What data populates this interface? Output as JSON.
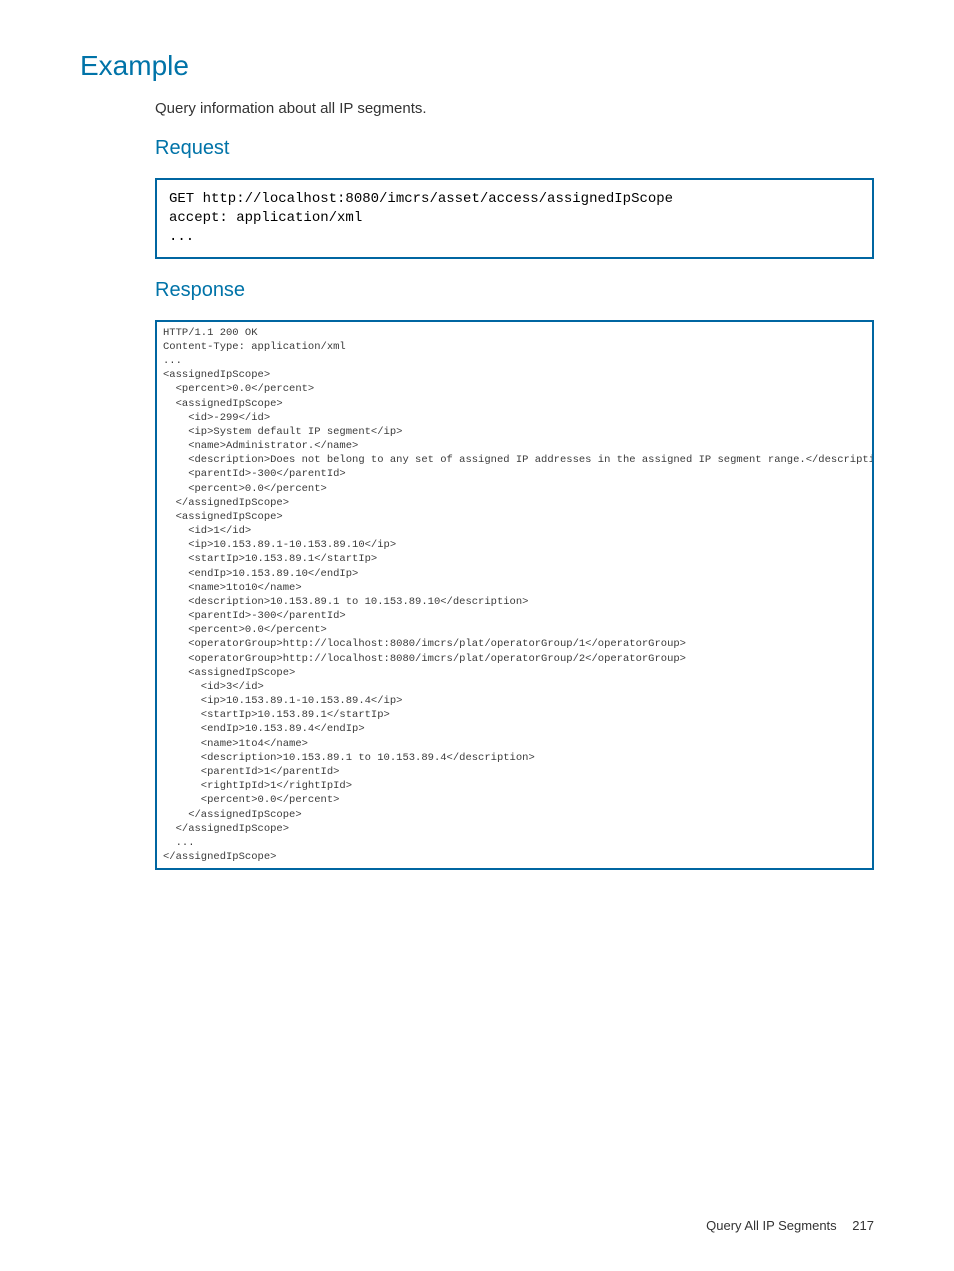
{
  "section": {
    "title": "Example",
    "intro": "Query information about all IP segments."
  },
  "request": {
    "heading": "Request",
    "code": "GET http://localhost:8080/imcrs/asset/access/assignedIpScope\naccept: application/xml\n..."
  },
  "response": {
    "heading": "Response",
    "code": "HTTP/1.1 200 OK\nContent-Type: application/xml\n...\n<assignedIpScope>\n  <percent>0.0</percent>\n  <assignedIpScope>\n    <id>-299</id>\n    <ip>System default IP segment</ip>\n    <name>Administrator.</name>\n    <description>Does not belong to any set of assigned IP addresses in the assigned IP segment range.</description>\n    <parentId>-300</parentId>\n    <percent>0.0</percent>\n  </assignedIpScope>\n  <assignedIpScope>\n    <id>1</id>\n    <ip>10.153.89.1-10.153.89.10</ip>\n    <startIp>10.153.89.1</startIp>\n    <endIp>10.153.89.10</endIp>\n    <name>1to10</name>\n    <description>10.153.89.1 to 10.153.89.10</description>\n    <parentId>-300</parentId>\n    <percent>0.0</percent>\n    <operatorGroup>http://localhost:8080/imcrs/plat/operatorGroup/1</operatorGroup>\n    <operatorGroup>http://localhost:8080/imcrs/plat/operatorGroup/2</operatorGroup>\n    <assignedIpScope>\n      <id>3</id>\n      <ip>10.153.89.1-10.153.89.4</ip>\n      <startIp>10.153.89.1</startIp>\n      <endIp>10.153.89.4</endIp>\n      <name>1to4</name>\n      <description>10.153.89.1 to 10.153.89.4</description>\n      <parentId>1</parentId>\n      <rightIpId>1</rightIpId>\n      <percent>0.0</percent>\n    </assignedIpScope>\n  </assignedIpScope>\n  ...\n</assignedIpScope>"
  },
  "footer": {
    "title": "Query All IP Segments",
    "page": "217"
  }
}
